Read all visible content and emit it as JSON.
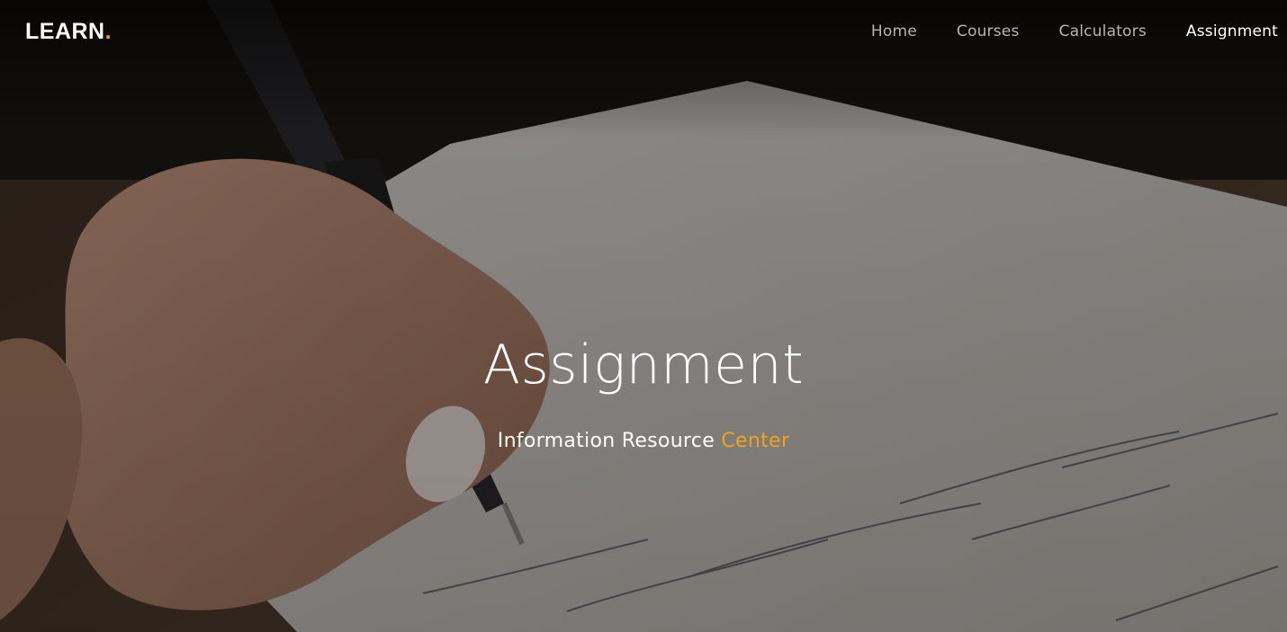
{
  "logo": {
    "text": "LEARN",
    "dot": "."
  },
  "nav": {
    "items": [
      {
        "label": "Home",
        "active": false
      },
      {
        "label": "Courses",
        "active": false
      },
      {
        "label": "Calculators",
        "active": false
      },
      {
        "label": "Assignment",
        "active": true
      }
    ]
  },
  "hero": {
    "title": "Assignment",
    "subtitle_main": "Information Resource",
    "subtitle_accent": "Center",
    "background_image": "hand-writing-on-notebook-photo"
  },
  "colors": {
    "accent": "#f2a31b",
    "nav_text": "#b9b4ae",
    "nav_active": "#ffffff"
  }
}
